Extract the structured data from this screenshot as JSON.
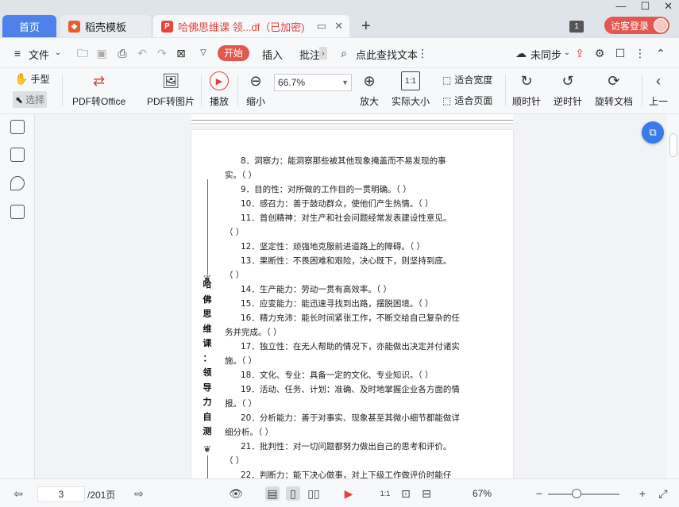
{
  "tabs": {
    "home": "首页",
    "template": "稻壳模板",
    "document": "哈佛思维课 领...df（已加密)"
  },
  "window": {
    "page_badge": "1",
    "login": "访客登录"
  },
  "menu": {
    "file": "文件",
    "start": "开始",
    "insert": "插入",
    "annotate": "批注",
    "search": "点此查找文本",
    "sync": "未同步"
  },
  "toolbar": {
    "hand": "手型",
    "select": "选择",
    "pdf_to_office": "PDF转Office",
    "pdf_to_image": "PDF转图片",
    "play": "播放",
    "zoom_out": "缩小",
    "zoom_value": "66.7%",
    "zoom_in": "放大",
    "actual_size": "实际大小",
    "fit_width": "适合宽度",
    "fit_page": "适合页面",
    "rotate_cw": "顺时针",
    "rotate_ccw": "逆时针",
    "rotate_doc": "旋转文档",
    "prev": "上一"
  },
  "document": {
    "side_title": [
      "哈",
      "佛",
      "思",
      "维",
      "课",
      "：",
      "领",
      "导",
      "力",
      "自",
      "测"
    ],
    "lines": [
      {
        "text": "8．洞察力：能洞察那些被其他现象掩盖而不易发现的事",
        "indent": true
      },
      {
        "text": "实。（ ）",
        "indent": false
      },
      {
        "text": "9．目的性：对所做的工作目的一贯明确。（ ）",
        "indent": true
      },
      {
        "text": "10．感召力：善于鼓动群众，使他们产生热情。（ ）",
        "indent": true
      },
      {
        "text": "11．首创精神：对生产和社会问题经常发表建设性意见。",
        "indent": true
      },
      {
        "text": "（ ）",
        "indent": false
      },
      {
        "text": "12．坚定性：顽强地克服前进道路上的障碍。（ ）",
        "indent": true
      },
      {
        "text": "13．果断性：不畏困难和艰险，决心既下，则坚持到底。",
        "indent": true
      },
      {
        "text": "（ ）",
        "indent": false
      },
      {
        "text": "14．生产能力：劳动一贯有高效率。（ ）",
        "indent": true
      },
      {
        "text": "15．应变能力：能迅速寻找到出路，摆脱困境。（ ）",
        "indent": true
      },
      {
        "text": "16．精力充沛：能长时间紧张工作，不断交给自己复杂的任",
        "indent": true
      },
      {
        "text": "务并完成。（ ）",
        "indent": false
      },
      {
        "text": "17．独立性：在无人帮助的情况下，亦能做出决定并付诸实",
        "indent": true
      },
      {
        "text": "施。（ ）",
        "indent": false
      },
      {
        "text": "18．文化、专业：具备一定的文化、专业知识。（ ）",
        "indent": true
      },
      {
        "text": "19．活动、任务、计划：准确、及时地掌握企业各方面的情",
        "indent": true
      },
      {
        "text": "报。（ ）",
        "indent": false
      },
      {
        "text": "20．分析能力：善于对事实、现象甚至其微小细节都能做详",
        "indent": true
      },
      {
        "text": "细分析。（ ）",
        "indent": false
      },
      {
        "text": "21．批判性：对一切问题都努力做出自己的思考和评价。",
        "indent": true
      },
      {
        "text": "（ ）",
        "indent": false
      },
      {
        "text": "22．判断力：能下决心做事，对上下级工作做评价时能仔",
        "indent": true
      }
    ]
  },
  "status": {
    "current_page": "3",
    "total_pages": "/201页",
    "zoom": "67%",
    "zoom_level": 0.4
  }
}
